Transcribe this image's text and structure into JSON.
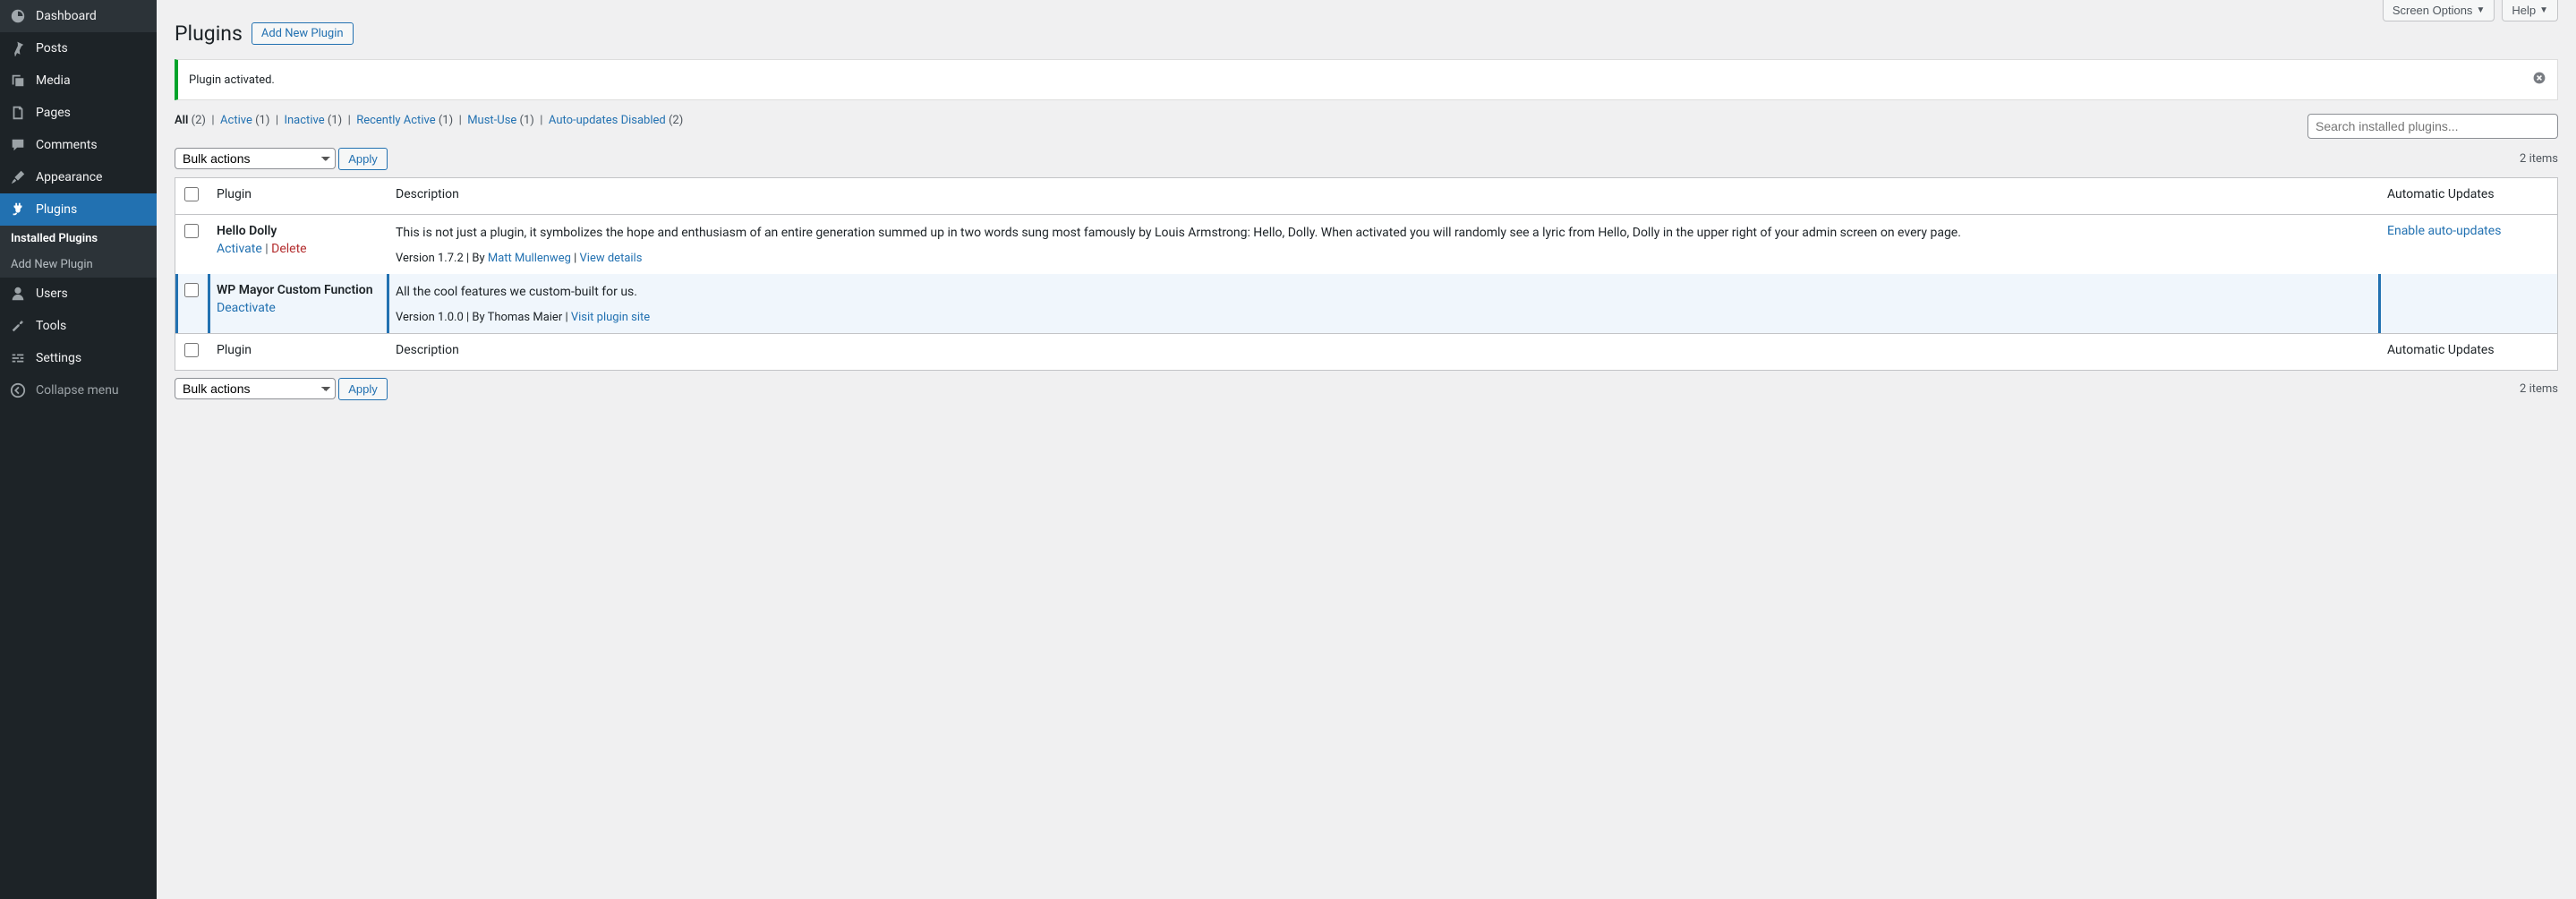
{
  "sidebar": {
    "dashboard": "Dashboard",
    "posts": "Posts",
    "media": "Media",
    "pages": "Pages",
    "comments": "Comments",
    "appearance": "Appearance",
    "plugins": "Plugins",
    "plugins_sub_installed": "Installed Plugins",
    "plugins_sub_add": "Add New Plugin",
    "users": "Users",
    "tools": "Tools",
    "settings": "Settings",
    "collapse": "Collapse menu"
  },
  "top": {
    "screen_options": "Screen Options",
    "help": "Help"
  },
  "header": {
    "title": "Plugins",
    "add_new": "Add New Plugin"
  },
  "notice": {
    "text": "Plugin activated."
  },
  "filters": {
    "all_label": "All",
    "all_count": "(2)",
    "active_label": "Active",
    "active_count": "(1)",
    "inactive_label": "Inactive",
    "inactive_count": "(1)",
    "recent_label": "Recently Active",
    "recent_count": "(1)",
    "mustuse_label": "Must-Use",
    "mustuse_count": "(1)",
    "autodisabled_label": "Auto-updates Disabled",
    "autodisabled_count": "(2)",
    "search_placeholder": "Search installed plugins..."
  },
  "bulk": {
    "label": "Bulk actions",
    "apply": "Apply",
    "items": "2 items"
  },
  "table": {
    "col_plugin": "Plugin",
    "col_description": "Description",
    "col_auto": "Automatic Updates"
  },
  "plugins": {
    "hello": {
      "name": "Hello Dolly",
      "activate": "Activate",
      "delete": "Delete",
      "description": "This is not just a plugin, it symbolizes the hope and enthusiasm of an entire generation summed up in two words sung most famously by Louis Armstrong: Hello, Dolly. When activated you will randomly see a lyric from Hello, Dolly in the upper right of your admin screen on every page.",
      "version_by": "Version 1.7.2 | By ",
      "author": "Matt Mullenweg",
      "sep": " | ",
      "details": "View details",
      "auto": "Enable auto-updates"
    },
    "wpmayor": {
      "name": "WP Mayor Custom Function",
      "deactivate": "Deactivate",
      "description": "All the cool features we custom-built for us.",
      "version_by": "Version 1.0.0 | By Thomas Maier | ",
      "site": "Visit plugin site"
    }
  }
}
